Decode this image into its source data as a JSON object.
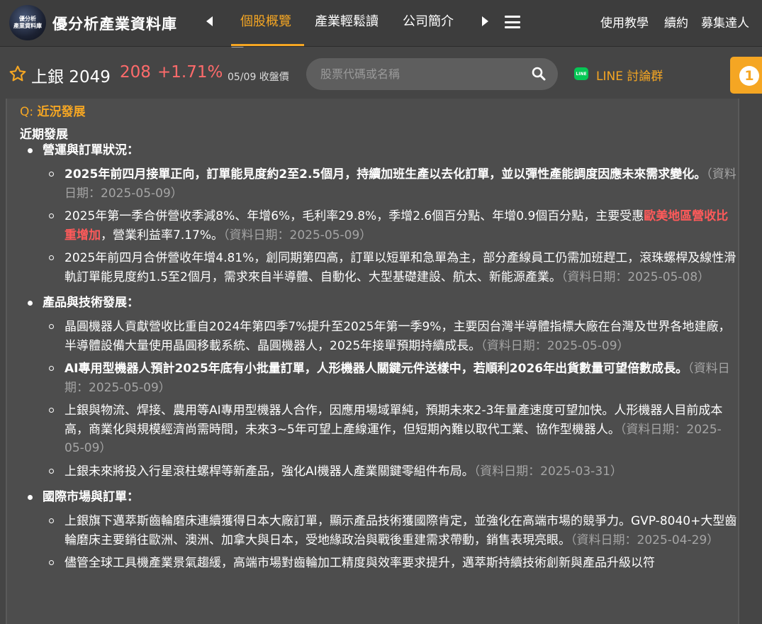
{
  "header": {
    "logo_line1": "優分析",
    "logo_line2": "產業資料庫",
    "brand": "優分析產業資料庫",
    "tabs": [
      {
        "label": "個股概覽",
        "active": true
      },
      {
        "label": "產業輕鬆讀",
        "active": false
      },
      {
        "label": "公司簡介",
        "active": false
      }
    ],
    "links": [
      "使用教學",
      "續約",
      "募集達人"
    ]
  },
  "stock": {
    "name": "上銀 2049",
    "price": "208",
    "change": "+1.71%",
    "date": "05/09 收盤價"
  },
  "search": {
    "placeholder": "股票代碼或名稱"
  },
  "line": {
    "icon_text": "LINE",
    "label": "LINE 討論群"
  },
  "badge": {
    "count": "1"
  },
  "content": {
    "q_prefix": "Q: ",
    "q_title": "近況發展",
    "section": "近期發展",
    "categories": [
      {
        "title": "營運與訂單狀況：",
        "items": [
          {
            "text": "2025年前四月接單正向，訂單能見度約2至2.5個月，持續加班生產以去化訂單，並以彈性產能調度因應未來需求變化。",
            "date": "（資料日期：2025-05-09）",
            "bold": true
          },
          {
            "text_before": "2025年第一季合併營收季減8%、年增6%，毛利率29.8%，季增2.6個百分點、年增0.9個百分點，主要受惠",
            "highlight": "歐美地區營收比重增加",
            "text_after": "，營業利益率7.17%。",
            "date": "（資料日期：2025-05-09）"
          },
          {
            "text": "2025年前四月合併營收年增4.81%，創同期第四高，訂單以短單和急單為主，部分產線員工仍需加班趕工，滾珠螺桿及線性滑軌訂單能見度約1.5至2個月，需求來自半導體、自動化、大型基礎建設、航太、新能源產業。",
            "date": "（資料日期：2025-05-08）",
            "bold": false
          }
        ]
      },
      {
        "title": "產品與技術發展：",
        "items": [
          {
            "text": "晶圓機器人貢獻營收比重自2024年第四季7%提升至2025年第一季9%，主要因台灣半導體指標大廠在台灣及世界各地建廠，半導體設備大量使用晶圓移載系統、晶圓機器人，2025年接單預期持續成長。",
            "date": "（資料日期：2025-05-09）",
            "bold": false
          },
          {
            "text": "AI專用型機器人預計2025年底有小批量訂單，人形機器人關鍵元件送樣中，若順利2026年出貨數量可望倍數成長。",
            "date": "（資料日期：2025-05-09）",
            "bold": true
          },
          {
            "text": "上銀與物流、焊接、農用等AI專用型機器人合作，因應用場域單純，預期未來2-3年量產速度可望加快。人形機器人目前成本高，商業化與規模經濟尚需時間，未來3~5年可望上產線運作，但短期內難以取代工業、協作型機器人。",
            "date": "（資料日期：2025-05-09）",
            "bold": false
          },
          {
            "text": "上銀未來將投入行星滾柱螺桿等新產品，強化AI機器人產業關鍵零組件布局。",
            "date": "（資料日期：2025-03-31）",
            "bold": false
          }
        ]
      },
      {
        "title": "國際市場與訂單：",
        "items": [
          {
            "text": "上銀旗下邁萃斯齒輪磨床連續獲得日本大廠訂單，顯示產品技術獲國際肯定，並強化在高端市場的競爭力。GVP-8040+大型齒輪磨床主要銷往歐洲、澳洲、加拿大與日本，受地緣政治與戰後重建需求帶動，銷售表現亮眼。",
            "date": "（資料日期：2025-04-29）",
            "bold": false
          },
          {
            "text": "儘管全球工具機產業景氣趨緩，高端市場對齒輪加工精度與效率要求提升，邁萃斯持續技術創新與產品升級以符",
            "date": "",
            "bold": false
          }
        ]
      }
    ]
  }
}
